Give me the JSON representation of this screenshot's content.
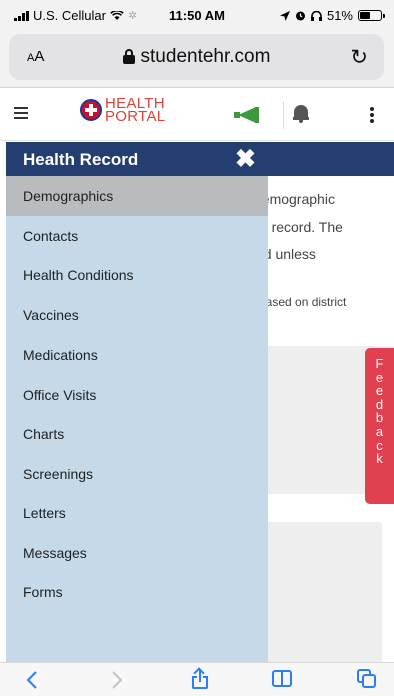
{
  "status_bar": {
    "carrier": "U.S. Cellular",
    "time": "11:50 AM",
    "battery": "51%",
    "battery_level": 0.51
  },
  "browser": {
    "text_size_label": "AA",
    "url": "studentehr.com",
    "reload_icon": "reload-icon"
  },
  "app_header": {
    "logo_line1": "HEALTH",
    "logo_line2": "PORTAL",
    "megaphone_color": "#3c9a3c",
    "logo_color": "#d9453a"
  },
  "drawer": {
    "title": "Health Record",
    "close_label": "✖",
    "header_color": "#253e72",
    "body_color": "#c5d9e8",
    "items": [
      {
        "label": "Demographics",
        "active": true
      },
      {
        "label": "Contacts"
      },
      {
        "label": "Health Conditions"
      },
      {
        "label": "Vaccines"
      },
      {
        "label": "Medications"
      },
      {
        "label": "Office Visits"
      },
      {
        "label": "Charts"
      },
      {
        "label": "Screenings"
      },
      {
        "label": "Letters"
      },
      {
        "label": "Messages"
      },
      {
        "label": "Forms"
      }
    ]
  },
  "background_content": {
    "line1": "demographic",
    "line2": "th record. The",
    "line3": "ed unless",
    "line4": "based on district"
  },
  "feedback": {
    "label": "Feedback",
    "color": "#e0404f"
  },
  "toolbar": {
    "back": "‹",
    "forward": "›"
  }
}
